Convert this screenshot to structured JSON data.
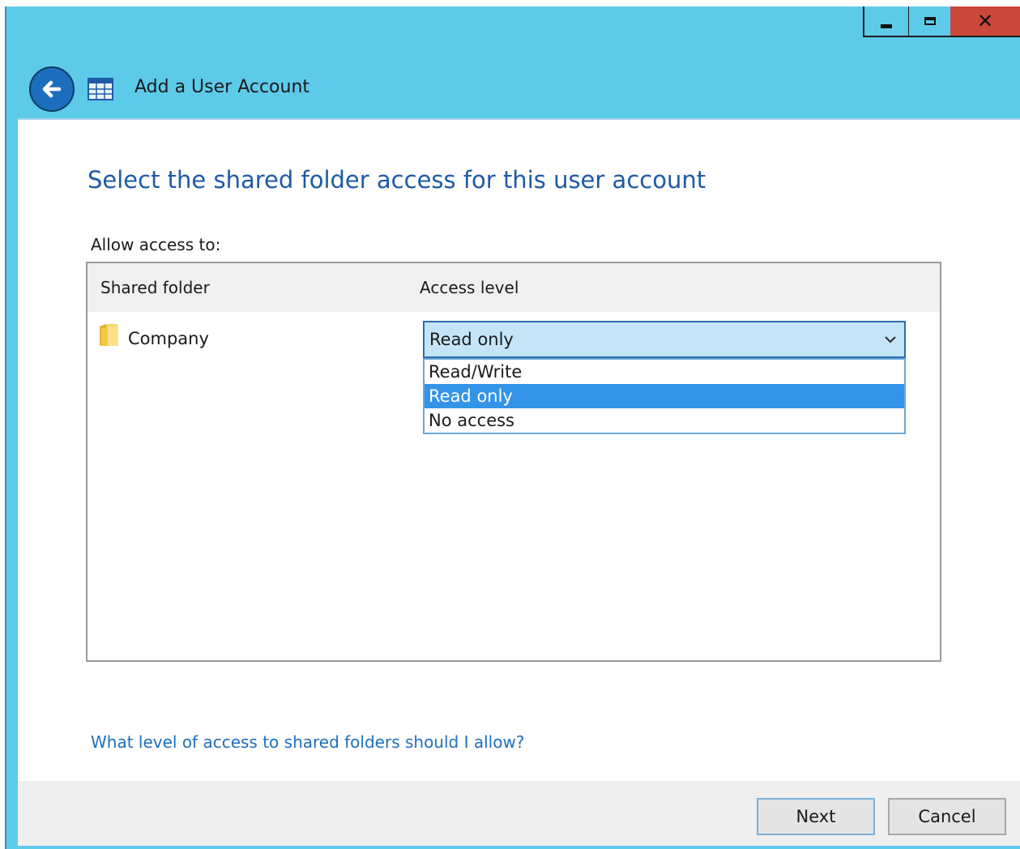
{
  "window": {
    "title": "Add a User Account",
    "controls": {
      "minimize": "minimize-icon",
      "maximize": "maximize-icon",
      "close": "✕"
    }
  },
  "page": {
    "heading": "Select the shared folder access for this user account",
    "allow_label": "Allow access to:"
  },
  "table": {
    "columns": [
      "Shared folder",
      "Access level"
    ],
    "rows": [
      {
        "folder": "Company",
        "access": "Read only"
      }
    ]
  },
  "dropdown": {
    "options": [
      "Read/Write",
      "Read only",
      "No access"
    ],
    "highlighted": "Read only"
  },
  "help_link": "What level of access to shared folders should I allow?",
  "buttons": {
    "next": "Next",
    "cancel": "Cancel"
  },
  "colors": {
    "titlebar": "#5ecaea",
    "close_button": "#c9483b",
    "heading": "#1e5aa6",
    "link": "#1e6fbe",
    "selection": "#3394e8"
  }
}
